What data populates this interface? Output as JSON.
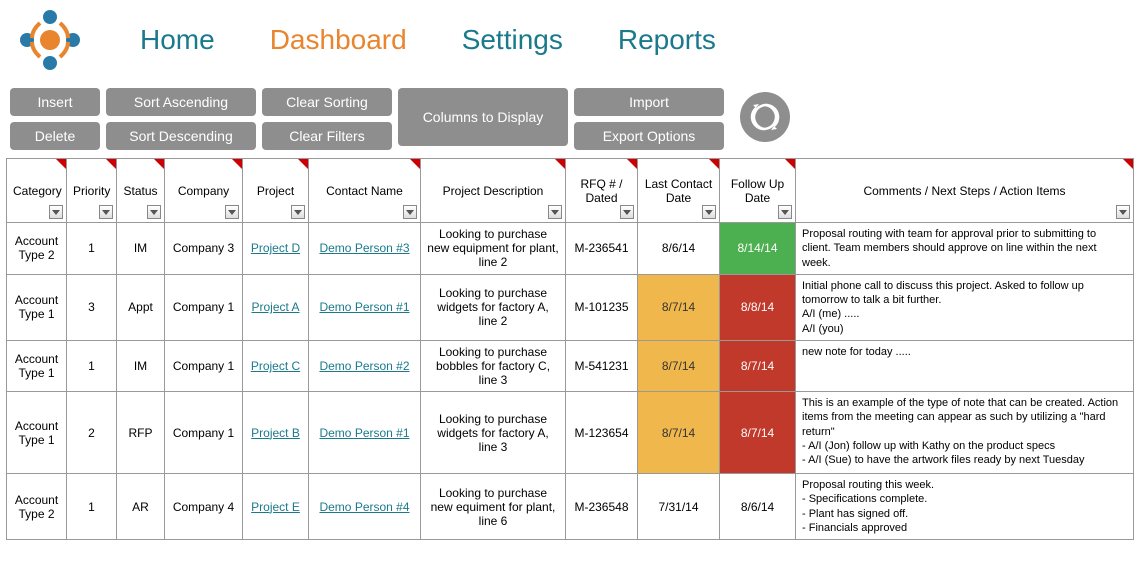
{
  "nav": {
    "home": "Home",
    "dashboard": "Dashboard",
    "settings": "Settings",
    "reports": "Reports"
  },
  "toolbar": {
    "insert": "Insert",
    "delete": "Delete",
    "sort_asc": "Sort Ascending",
    "sort_desc": "Sort Descending",
    "clear_sorting": "Clear Sorting",
    "clear_filters": "Clear Filters",
    "columns": "Columns to Display",
    "import": "Import",
    "export": "Export Options"
  },
  "columns": {
    "category": "Category",
    "priority": "Priority",
    "status": "Status",
    "company": "Company",
    "project": "Project",
    "contact": "Contact Name",
    "description": "Project Description",
    "rfq": "RFQ # / Dated",
    "last_contact": "Last Contact Date",
    "follow_up": "Follow Up Date",
    "comments": "Comments / Next Steps / Action Items"
  },
  "rows": [
    {
      "category": "Account Type 2",
      "priority": "1",
      "status": "IM",
      "company": "Company 3",
      "project": "Project D",
      "contact": "Demo Person #3",
      "description": "Looking to purchase new equipment for plant, line 2",
      "rfq": "M-236541",
      "last_contact": "8/6/14",
      "last_contact_color": "",
      "follow_up": "8/14/14",
      "follow_up_color": "cell-green",
      "comments": "Proposal routing with team for approval prior to submitting to client. Team members should approve on line within the next week."
    },
    {
      "category": "Account Type 1",
      "priority": "3",
      "status": "Appt",
      "company": "Company 1",
      "project": "Project A",
      "contact": "Demo Person #1",
      "description": "Looking to purchase widgets for factory A, line 2",
      "rfq": "M-101235",
      "last_contact": "8/7/14",
      "last_contact_color": "cell-yellow",
      "follow_up": "8/8/14",
      "follow_up_color": "cell-red",
      "comments": "Initial phone call to discuss this project. Asked to follow up tomorrow to talk a bit further.\nA/I (me) .....\nA/I (you)"
    },
    {
      "category": "Account Type 1",
      "priority": "1",
      "status": "IM",
      "company": "Company 1",
      "project": "Project C",
      "contact": "Demo Person #2",
      "description": "Looking to purchase bobbles for factory C, line 3",
      "rfq": "M-541231",
      "last_contact": "8/7/14",
      "last_contact_color": "cell-yellow",
      "follow_up": "8/7/14",
      "follow_up_color": "cell-red",
      "comments": "new note for today ....."
    },
    {
      "category": "Account Type 1",
      "priority": "2",
      "status": "RFP",
      "company": "Company 1",
      "project": "Project B",
      "contact": "Demo Person #1",
      "description": "Looking to purchase widgets for factory A, line 3",
      "rfq": "M-123654",
      "last_contact": "8/7/14",
      "last_contact_color": "cell-yellow",
      "follow_up": "8/7/14",
      "follow_up_color": "cell-red",
      "comments": "This is an example of the type of note that can be created.  Action items from the meeting can appear as such by utilizing a \"hard return\"\n- A/I (Jon) follow up with Kathy on the product specs\n- A/I (Sue) to have the artwork files ready by next Tuesday"
    },
    {
      "category": "Account Type 2",
      "priority": "1",
      "status": "AR",
      "company": "Company 4",
      "project": "Project E",
      "contact": "Demo Person #4",
      "description": "Looking to purchase new equiment for plant, line 6",
      "rfq": "M-236548",
      "last_contact": "7/31/14",
      "last_contact_color": "",
      "follow_up": "8/6/14",
      "follow_up_color": "",
      "comments": "Proposal routing this week.\n- Specifications complete.\n- Plant has signed off.\n- Financials approved"
    }
  ]
}
